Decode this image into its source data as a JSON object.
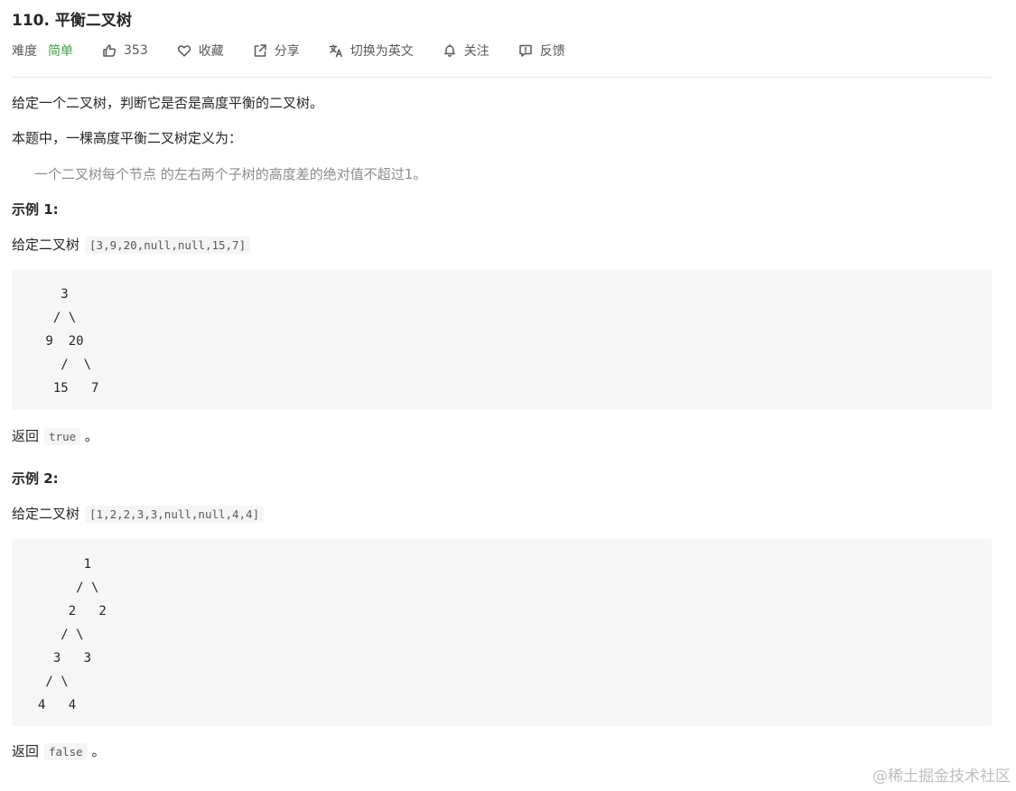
{
  "problem": {
    "title": "110. 平衡二叉树",
    "difficulty_label": "难度",
    "difficulty_value": "简单",
    "likes": "353",
    "favorite": "收藏",
    "share": "分享",
    "switch_lang": "切换为英文",
    "follow": "关注",
    "feedback": "反馈"
  },
  "content": {
    "intro": "给定一个二叉树，判断它是否是高度平衡的二叉树。",
    "definition_label": "本题中，一棵高度平衡二叉树定义为：",
    "definition_quote": "一个二叉树每个节点 的左右两个子树的高度差的绝对值不超过1。",
    "example1": {
      "title": "示例 1:",
      "given": "给定二叉树",
      "input": "[3,9,20,null,null,15,7]",
      "tree": "   3\n  / \\\n 9  20\n   /  \\\n  15   7",
      "return_label": "返回",
      "return_value": "true",
      "return_end": "。"
    },
    "example2": {
      "title": "示例 2:",
      "given": "给定二叉树",
      "input": "[1,2,2,3,3,null,null,4,4]",
      "tree": "      1\n     / \\\n    2   2\n   / \\\n  3   3\n / \\\n4   4",
      "return_label": "返回",
      "return_value": "false",
      "return_end": "。"
    }
  },
  "watermark": "@稀土掘金技术社区"
}
